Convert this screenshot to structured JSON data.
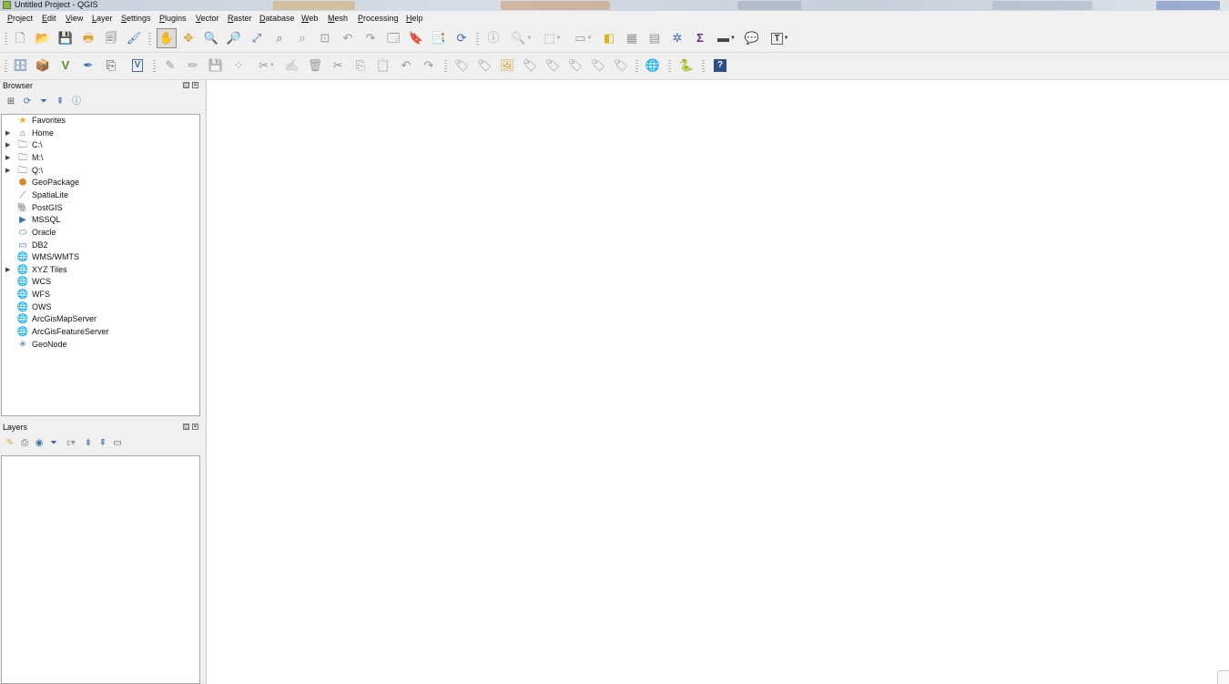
{
  "window": {
    "title": "Untitled Project - QGIS"
  },
  "menu": [
    "Project",
    "Edit",
    "View",
    "Layer",
    "Settings",
    "Plugins",
    "Vector",
    "Raster",
    "Database",
    "Web",
    "Mesh",
    "Processing",
    "Help"
  ],
  "toolbar1": [
    {
      "icon": "new-project-icon",
      "glyph": "🗋"
    },
    {
      "icon": "open-project-icon",
      "glyph": "📂"
    },
    {
      "icon": "save-project-icon",
      "glyph": "💾"
    },
    {
      "icon": "new-print-layout-icon",
      "glyph": "🖶"
    },
    {
      "icon": "layout-manager-icon",
      "glyph": "🗐"
    },
    {
      "icon": "style-manager-icon",
      "glyph": "🖌"
    },
    {
      "icon": "pan-map-icon",
      "glyph": "✋"
    },
    {
      "icon": "pan-to-selection-icon",
      "glyph": "✥"
    },
    {
      "icon": "zoom-in-icon",
      "glyph": "🔍"
    },
    {
      "icon": "zoom-out-icon",
      "glyph": "🔎"
    },
    {
      "icon": "zoom-full-icon",
      "glyph": "⤢"
    },
    {
      "icon": "zoom-to-selection-icon",
      "glyph": "⌕"
    },
    {
      "icon": "zoom-to-layer-icon",
      "glyph": "⌕"
    },
    {
      "icon": "zoom-native-icon",
      "glyph": "⊡"
    },
    {
      "icon": "zoom-last-icon",
      "glyph": "↶"
    },
    {
      "icon": "zoom-next-icon",
      "glyph": "↷"
    },
    {
      "icon": "new-map-view-icon",
      "glyph": "🗔"
    },
    {
      "icon": "new-bookmark-icon",
      "glyph": "🔖"
    },
    {
      "icon": "show-bookmarks-icon",
      "glyph": "📑"
    },
    {
      "icon": "refresh-icon",
      "glyph": "⟳"
    },
    {
      "icon": "identify-features-icon",
      "glyph": "ⓘ"
    },
    {
      "icon": "select-features-icon",
      "glyph": "⬚"
    },
    {
      "icon": "open-attribute-table-icon",
      "glyph": "▦"
    },
    {
      "icon": "statistics-icon",
      "glyph": "Σ"
    },
    {
      "icon": "measure-line-icon",
      "glyph": "📏"
    },
    {
      "icon": "map-tips-icon",
      "glyph": "💬"
    },
    {
      "icon": "text-annotation-icon",
      "glyph": "T"
    }
  ],
  "toolbar2": [
    {
      "icon": "data-source-manager-icon",
      "glyph": "🗄"
    },
    {
      "icon": "new-geopackage-layer-icon",
      "glyph": "📦"
    },
    {
      "icon": "new-shapefile-layer-icon",
      "glyph": "V"
    },
    {
      "icon": "new-spatialite-layer-icon",
      "glyph": "✒"
    },
    {
      "icon": "new-virtual-layer-icon",
      "glyph": "⎘"
    },
    {
      "icon": "add-vector-layer-icon",
      "glyph": "V"
    },
    {
      "icon": "current-edits-icon",
      "glyph": "✎"
    },
    {
      "icon": "toggle-editing-icon",
      "glyph": "✏"
    },
    {
      "icon": "save-layer-edits-icon",
      "glyph": "💾"
    },
    {
      "icon": "digitize-icon",
      "glyph": "⁘"
    },
    {
      "icon": "vertex-tool-icon",
      "glyph": "✂"
    },
    {
      "icon": "modify-attributes-icon",
      "glyph": "✍"
    },
    {
      "icon": "delete-selected-icon",
      "glyph": "🗑"
    },
    {
      "icon": "cut-features-icon",
      "glyph": "✂"
    },
    {
      "icon": "copy-features-icon",
      "glyph": "⎘"
    },
    {
      "icon": "paste-features-icon",
      "glyph": "📋"
    },
    {
      "icon": "undo-icon",
      "glyph": "↶"
    },
    {
      "icon": "redo-icon",
      "glyph": "↷"
    },
    {
      "icon": "label-toolbar-icon",
      "glyph": "🏷"
    },
    {
      "icon": "layer-labeling-icon",
      "glyph": "🏷"
    },
    {
      "icon": "pin-labels-icon",
      "glyph": "📌"
    },
    {
      "icon": "show-hide-labels-icon",
      "glyph": "🏷"
    },
    {
      "icon": "move-label-icon",
      "glyph": "🏷"
    },
    {
      "icon": "rotate-label-icon",
      "glyph": "🏷"
    },
    {
      "icon": "change-label-icon",
      "glyph": "🏷"
    },
    {
      "icon": "plugin-globe-icon",
      "glyph": "🌐"
    },
    {
      "icon": "python-console-icon",
      "glyph": "🐍"
    },
    {
      "icon": "help-icon",
      "glyph": "?"
    }
  ],
  "browser": {
    "title": "Browser",
    "tools": [
      "add-selected-layers-icon",
      "refresh-icon",
      "filter-icon",
      "collapse-all-icon",
      "properties-icon"
    ],
    "items": [
      {
        "label": "Favorites",
        "icon": "favorites-star-icon",
        "glyph": "★",
        "color": "#e3b11d",
        "expandable": false
      },
      {
        "label": "Home",
        "icon": "home-folder-icon",
        "glyph": "⌂",
        "color": "#666",
        "expandable": true
      },
      {
        "label": "C:\\",
        "icon": "folder-icon",
        "glyph": "🗀",
        "color": "#666",
        "expandable": true
      },
      {
        "label": "M:\\",
        "icon": "folder-icon",
        "glyph": "🗀",
        "color": "#666",
        "expandable": true
      },
      {
        "label": "Q:\\",
        "icon": "folder-icon",
        "glyph": "🗀",
        "color": "#666",
        "expandable": true
      },
      {
        "label": "GeoPackage",
        "icon": "geopackage-icon",
        "glyph": "⬢",
        "color": "#d8892b",
        "expandable": false
      },
      {
        "label": "SpatiaLite",
        "icon": "spatialite-icon",
        "glyph": "⟋",
        "color": "#3a6fb0",
        "expandable": false
      },
      {
        "label": "PostGIS",
        "icon": "postgis-icon",
        "glyph": "🐘",
        "color": "#3a6fb0",
        "expandable": false
      },
      {
        "label": "MSSQL",
        "icon": "mssql-icon",
        "glyph": "▶",
        "color": "#3a6fb0",
        "expandable": false
      },
      {
        "label": "Oracle",
        "icon": "oracle-icon",
        "glyph": "⬭",
        "color": "#3a6fb0",
        "expandable": false
      },
      {
        "label": "DB2",
        "icon": "db2-icon",
        "glyph": "▭",
        "color": "#3a6fb0",
        "expandable": false
      },
      {
        "label": "WMS/WMTS",
        "icon": "wms-globe-icon",
        "glyph": "🌐",
        "color": "#3a6fb0",
        "expandable": false
      },
      {
        "label": "XYZ Tiles",
        "icon": "xyz-tiles-icon",
        "glyph": "🌐",
        "color": "#3a6fb0",
        "expandable": true
      },
      {
        "label": "WCS",
        "icon": "wcs-globe-icon",
        "glyph": "🌐",
        "color": "#3a6fb0",
        "expandable": false
      },
      {
        "label": "WFS",
        "icon": "wfs-globe-icon",
        "glyph": "🌐",
        "color": "#3a6fb0",
        "expandable": false
      },
      {
        "label": "OWS",
        "icon": "ows-globe-icon",
        "glyph": "🌐",
        "color": "#3a6fb0",
        "expandable": false
      },
      {
        "label": "ArcGisMapServer",
        "icon": "arcgis-mapserver-icon",
        "glyph": "🌐",
        "color": "#3a6fb0",
        "expandable": false
      },
      {
        "label": "ArcGisFeatureServer",
        "icon": "arcgis-featureserver-icon",
        "glyph": "🌐",
        "color": "#3a6fb0",
        "expandable": false
      },
      {
        "label": "GeoNode",
        "icon": "geonode-icon",
        "glyph": "✳",
        "color": "#3a6fb0",
        "expandable": false
      }
    ]
  },
  "layers": {
    "title": "Layers",
    "tools": [
      "open-layer-styling-icon",
      "add-group-icon",
      "manage-map-themes-icon",
      "filter-legend-icon",
      "filter-expression-icon",
      "expand-all-icon",
      "collapse-all-icon",
      "remove-layer-icon"
    ]
  }
}
